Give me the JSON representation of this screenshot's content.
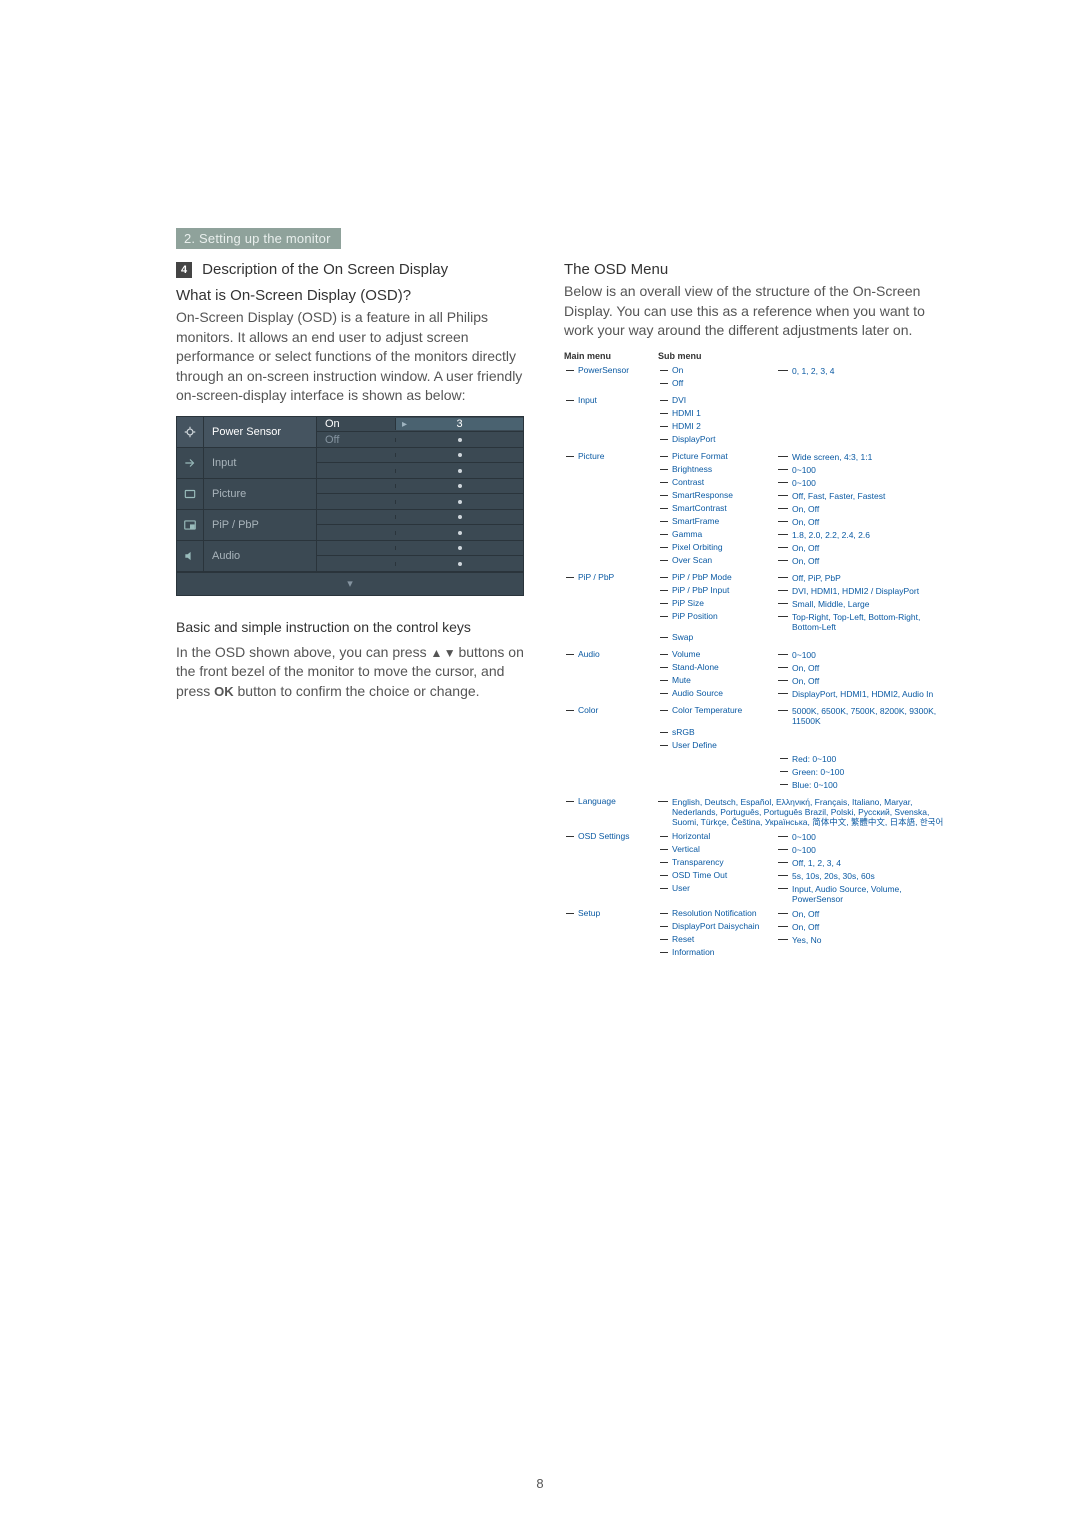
{
  "chapter_tag": "2. Setting up the monitor",
  "section_num": "4",
  "section_title": "Description of the On Screen Display",
  "what_heading": "What is On-Screen Display (OSD)?",
  "what_body": "On-Screen Display (OSD) is a feature in all Philips monitors. It allows an end user to adjust screen performance or select functions of the monitors directly through an on-screen instruction window. A user friendly on-screen-display interface is shown as below:",
  "osd": {
    "rows": [
      {
        "icon": "power-sensor-icon",
        "label": "Power Sensor",
        "selected": true,
        "sub1": "On",
        "sub2": "Off",
        "val1": "3"
      },
      {
        "icon": "input-icon",
        "label": "Input"
      },
      {
        "icon": "picture-icon",
        "label": "Picture"
      },
      {
        "icon": "pip-icon",
        "label": "PiP / PbP"
      },
      {
        "icon": "audio-icon",
        "label": "Audio"
      }
    ],
    "more": "▾"
  },
  "keys_heading": "Basic and simple instruction on the control keys",
  "keys_body_1": "In the OSD shown above, you can press ",
  "keys_arrows": "▲ ▼",
  "keys_body_2": " buttons on the front bezel of the monitor to move the cursor, and press ",
  "keys_ok": "OK",
  "keys_body_3": " button to confirm the choice or change.",
  "right_heading": "The OSD Menu",
  "right_body": "Below is an overall view of the structure of the On-Screen Display. You can use this as a reference when you want to work your way around the different adjustments later on.",
  "tree_header_main": "Main menu",
  "tree_header_sub": "Sub menu",
  "tree": [
    {
      "label": "PowerSensor",
      "subs": [
        {
          "label": "On",
          "vals": "0, 1, 2, 3, 4"
        },
        {
          "label": "Off"
        }
      ]
    },
    {
      "label": "Input",
      "subs": [
        {
          "label": "DVI"
        },
        {
          "label": "HDMI 1"
        },
        {
          "label": "HDMI 2"
        },
        {
          "label": "DisplayPort"
        }
      ]
    },
    {
      "label": "Picture",
      "subs": [
        {
          "label": "Picture Format",
          "vals": "Wide screen, 4:3, 1:1"
        },
        {
          "label": "Brightness",
          "vals": "0~100"
        },
        {
          "label": "Contrast",
          "vals": "0~100"
        },
        {
          "label": "SmartResponse",
          "vals": "Off, Fast, Faster, Fastest"
        },
        {
          "label": "SmartContrast",
          "vals": "On, Off"
        },
        {
          "label": "SmartFrame",
          "vals": "On, Off"
        },
        {
          "label": "Gamma",
          "vals": "1.8, 2.0, 2.2, 2.4, 2.6"
        },
        {
          "label": "Pixel Orbiting",
          "vals": "On, Off"
        },
        {
          "label": "Over Scan",
          "vals": "On, Off"
        }
      ]
    },
    {
      "label": "PiP / PbP",
      "subs": [
        {
          "label": "PiP / PbP Mode",
          "vals": "Off, PiP, PbP"
        },
        {
          "label": "PiP / PbP Input",
          "vals": "DVI, HDMI1, HDMI2 / DisplayPort"
        },
        {
          "label": "PiP Size",
          "vals": "Small, Middle, Large"
        },
        {
          "label": "PiP Position",
          "vals": "Top-Right, Top-Left, Bottom-Right, Bottom-Left"
        },
        {
          "label": "Swap"
        }
      ]
    },
    {
      "label": "Audio",
      "subs": [
        {
          "label": "Volume",
          "vals": "0~100"
        },
        {
          "label": "Stand-Alone",
          "vals": "On, Off"
        },
        {
          "label": "Mute",
          "vals": "On, Off"
        },
        {
          "label": "Audio Source",
          "vals": "DisplayPort, HDMI1, HDMI2, Audio In"
        }
      ]
    },
    {
      "label": "Color",
      "subs": [
        {
          "label": "Color Temperature",
          "vals": "5000K, 6500K, 7500K, 8200K, 9300K, 11500K"
        },
        {
          "label": "sRGB"
        },
        {
          "label": "User Define",
          "nested": [
            {
              "label": "Red: 0~100"
            },
            {
              "label": "Green: 0~100"
            },
            {
              "label": "Blue: 0~100"
            }
          ]
        }
      ]
    },
    {
      "label": "Language",
      "vals_only": "English, Deutsch, Español, Ελληνική, Français, Italiano, Maryar, Nederlands, Português, Português Brazil, Polski, Русский, Svenska, Suomi, Türkçe, Čeština, Українська, 简体中文, 繁體中文, 日本語, 한국어"
    },
    {
      "label": "OSD Settings",
      "subs": [
        {
          "label": "Horizontal",
          "vals": "0~100"
        },
        {
          "label": "Vertical",
          "vals": "0~100"
        },
        {
          "label": "Transparency",
          "vals": "Off, 1, 2, 3, 4"
        },
        {
          "label": "OSD Time Out",
          "vals": "5s, 10s, 20s, 30s, 60s"
        },
        {
          "label": "User",
          "vals": "Input, Audio Source, Volume, PowerSensor"
        }
      ]
    },
    {
      "label": "Setup",
      "subs": [
        {
          "label": "Resolution Notification",
          "vals": "On, Off"
        },
        {
          "label": "DisplayPort Daisychain",
          "vals": "On, Off"
        },
        {
          "label": "Reset",
          "vals": "Yes, No"
        },
        {
          "label": "Information"
        }
      ]
    }
  ],
  "page_number": "8"
}
